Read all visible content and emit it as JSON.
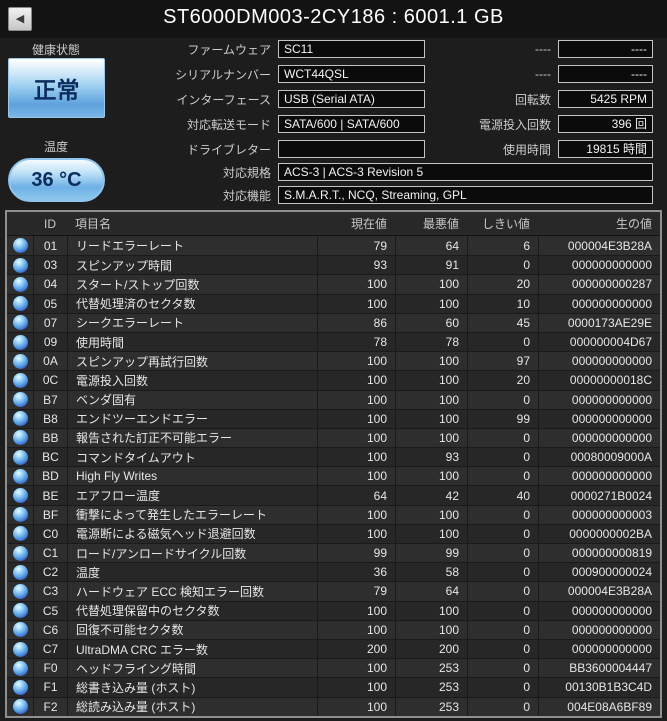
{
  "window": {
    "title": "ST6000DM003-2CY186 : 6001.1 GB",
    "back_icon": "◀"
  },
  "colors": {
    "health_good": "#79b6e6",
    "status_orb_blue": "#58a0e8"
  },
  "health": {
    "label": "健康状態",
    "status": "正常",
    "temp_label": "温度",
    "temperature": "36 °C"
  },
  "info_mid": [
    {
      "label": "ファームウェア",
      "value": "SC11"
    },
    {
      "label": "シリアルナンバー",
      "value": "WCT44QSL"
    },
    {
      "label": "インターフェース",
      "value": "USB (Serial ATA)"
    },
    {
      "label": "対応転送モード",
      "value": "SATA/600 | SATA/600"
    },
    {
      "label": "ドライブレター",
      "value": ""
    }
  ],
  "info_right": [
    {
      "label": "----",
      "value": "----"
    },
    {
      "label": "----",
      "value": "----"
    },
    {
      "label": "回転数",
      "value": "5425 RPM"
    },
    {
      "label": "電源投入回数",
      "value": "396 回"
    },
    {
      "label": "使用時間",
      "value": "19815 時間"
    }
  ],
  "info_wide": [
    {
      "label": "対応規格",
      "value": "ACS-3 | ACS-3 Revision 5"
    },
    {
      "label": "対応機能",
      "value": "S.M.A.R.T., NCQ, Streaming, GPL"
    }
  ],
  "smart_table": {
    "headers": {
      "id": "ID",
      "name": "項目名",
      "current": "現在値",
      "worst": "最悪値",
      "threshold": "しきい値",
      "raw": "生の値"
    },
    "rows": [
      {
        "id": "01",
        "name": "リードエラーレート",
        "current": "79",
        "worst": "64",
        "threshold": "6",
        "raw": "000004E3B28A"
      },
      {
        "id": "03",
        "name": "スピンアップ時間",
        "current": "93",
        "worst": "91",
        "threshold": "0",
        "raw": "000000000000"
      },
      {
        "id": "04",
        "name": "スタート/ストップ回数",
        "current": "100",
        "worst": "100",
        "threshold": "20",
        "raw": "000000000287"
      },
      {
        "id": "05",
        "name": "代替処理済のセクタ数",
        "current": "100",
        "worst": "100",
        "threshold": "10",
        "raw": "000000000000"
      },
      {
        "id": "07",
        "name": "シークエラーレート",
        "current": "86",
        "worst": "60",
        "threshold": "45",
        "raw": "0000173AE29E"
      },
      {
        "id": "09",
        "name": "使用時間",
        "current": "78",
        "worst": "78",
        "threshold": "0",
        "raw": "000000004D67"
      },
      {
        "id": "0A",
        "name": "スピンアップ再試行回数",
        "current": "100",
        "worst": "100",
        "threshold": "97",
        "raw": "000000000000"
      },
      {
        "id": "0C",
        "name": "電源投入回数",
        "current": "100",
        "worst": "100",
        "threshold": "20",
        "raw": "00000000018C"
      },
      {
        "id": "B7",
        "name": "ベンダ固有",
        "current": "100",
        "worst": "100",
        "threshold": "0",
        "raw": "000000000000"
      },
      {
        "id": "B8",
        "name": "エンドツーエンドエラー",
        "current": "100",
        "worst": "100",
        "threshold": "99",
        "raw": "000000000000"
      },
      {
        "id": "BB",
        "name": "報告された訂正不可能エラー",
        "current": "100",
        "worst": "100",
        "threshold": "0",
        "raw": "000000000000"
      },
      {
        "id": "BC",
        "name": "コマンドタイムアウト",
        "current": "100",
        "worst": "93",
        "threshold": "0",
        "raw": "00080009000A"
      },
      {
        "id": "BD",
        "name": "High Fly Writes",
        "current": "100",
        "worst": "100",
        "threshold": "0",
        "raw": "000000000000"
      },
      {
        "id": "BE",
        "name": "エアフロー温度",
        "current": "64",
        "worst": "42",
        "threshold": "40",
        "raw": "0000271B0024"
      },
      {
        "id": "BF",
        "name": "衝撃によって発生したエラーレート",
        "current": "100",
        "worst": "100",
        "threshold": "0",
        "raw": "000000000003"
      },
      {
        "id": "C0",
        "name": "電源断による磁気ヘッド退避回数",
        "current": "100",
        "worst": "100",
        "threshold": "0",
        "raw": "0000000002BA"
      },
      {
        "id": "C1",
        "name": "ロード/アンロードサイクル回数",
        "current": "99",
        "worst": "99",
        "threshold": "0",
        "raw": "000000000819"
      },
      {
        "id": "C2",
        "name": "温度",
        "current": "36",
        "worst": "58",
        "threshold": "0",
        "raw": "000900000024"
      },
      {
        "id": "C3",
        "name": "ハードウェア ECC 検知エラー回数",
        "current": "79",
        "worst": "64",
        "threshold": "0",
        "raw": "000004E3B28A"
      },
      {
        "id": "C5",
        "name": "代替処理保留中のセクタ数",
        "current": "100",
        "worst": "100",
        "threshold": "0",
        "raw": "000000000000"
      },
      {
        "id": "C6",
        "name": "回復不可能セクタ数",
        "current": "100",
        "worst": "100",
        "threshold": "0",
        "raw": "000000000000"
      },
      {
        "id": "C7",
        "name": "UltraDMA CRC エラー数",
        "current": "200",
        "worst": "200",
        "threshold": "0",
        "raw": "000000000000"
      },
      {
        "id": "F0",
        "name": "ヘッドフライング時間",
        "current": "100",
        "worst": "253",
        "threshold": "0",
        "raw": "BB3600004447"
      },
      {
        "id": "F1",
        "name": "総書き込み量 (ホスト)",
        "current": "100",
        "worst": "253",
        "threshold": "0",
        "raw": "00130B1B3C4D"
      },
      {
        "id": "F2",
        "name": "総読み込み量 (ホスト)",
        "current": "100",
        "worst": "253",
        "threshold": "0",
        "raw": "004E08A6BF89"
      }
    ]
  }
}
